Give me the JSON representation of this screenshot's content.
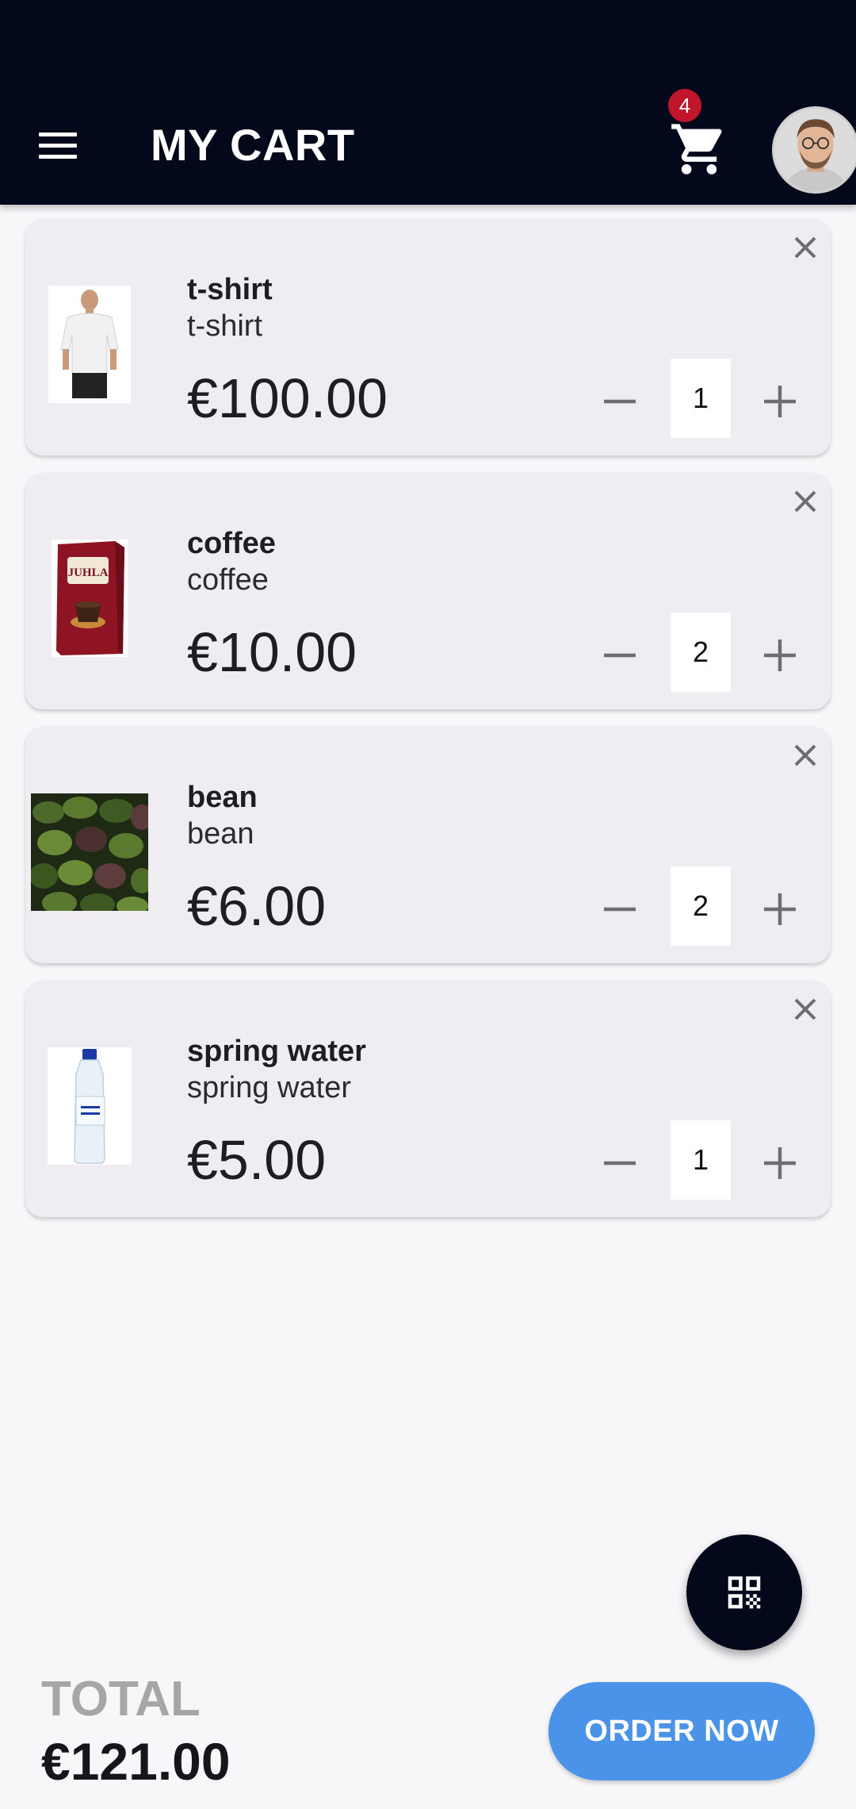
{
  "header": {
    "title": "MY CART",
    "cart_count": "4",
    "icons": {
      "menu": "menu-icon",
      "cart": "shopping-cart-icon",
      "avatar": "user-avatar"
    }
  },
  "items": [
    {
      "name": "t-shirt",
      "subtitle": "t-shirt",
      "price": "€100.00",
      "quantity": "1",
      "image": "t-shirt-image"
    },
    {
      "name": "coffee",
      "subtitle": "coffee",
      "price": "€10.00",
      "quantity": "2",
      "image": "coffee-package-image"
    },
    {
      "name": "bean",
      "subtitle": "bean",
      "price": "€6.00",
      "quantity": "2",
      "image": "avocado-image"
    },
    {
      "name": "spring water",
      "subtitle": "spring water",
      "price": "€5.00",
      "quantity": "1",
      "image": "water-bottle-image"
    }
  ],
  "footer": {
    "total_label": "TOTAL",
    "total_value": "€121.00",
    "order_button": "ORDER NOW"
  },
  "colors": {
    "appbar": "#03081a",
    "badge": "#c0152a",
    "order_button": "#4a93e8",
    "card": "#efedf2"
  }
}
